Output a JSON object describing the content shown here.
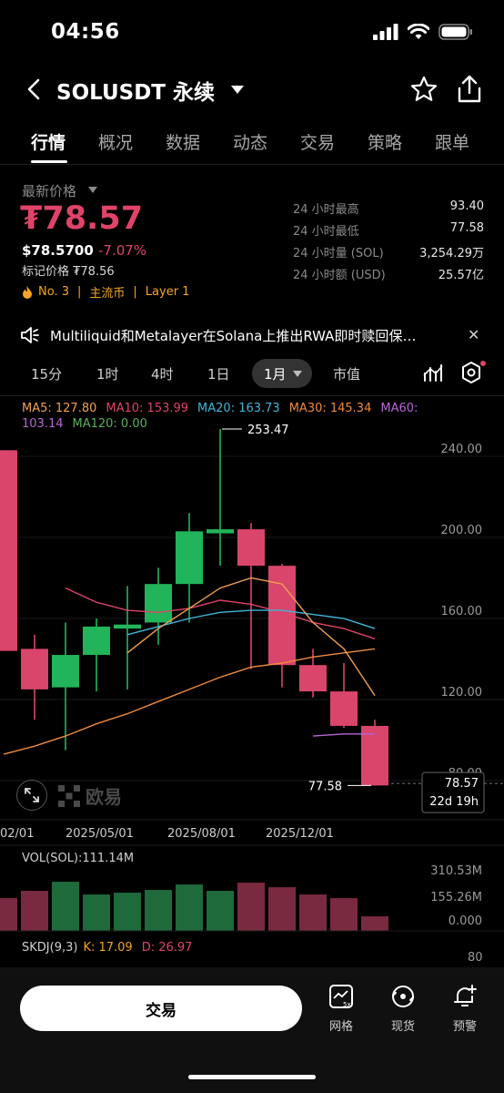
{
  "status": {
    "time": "04:56"
  },
  "header": {
    "pair": "SOLUSDT 永续"
  },
  "tabs": [
    "行情",
    "概况",
    "数据",
    "动态",
    "交易",
    "策略",
    "跟单"
  ],
  "price": {
    "label": "最新价格",
    "value": "₮78.57",
    "usd": "$78.5700",
    "change": "-7.07%",
    "mark": "标记价格 ₮78.56",
    "tags": [
      "No. 3",
      "主流币",
      "Layer 1"
    ]
  },
  "stats": [
    {
      "label": "24 小时最高",
      "value": "93.40"
    },
    {
      "label": "24 小时最低",
      "value": "77.58"
    },
    {
      "label": "24 小时量 (SOL)",
      "value": "3,254.29万"
    },
    {
      "label": "24 小时额 (USD)",
      "value": "25.57亿"
    }
  ],
  "news": {
    "text": "Multiliquid和Metalayer在Solana上推出RWA即时赎回保…"
  },
  "intervals": [
    "15分",
    "1时",
    "4时",
    "1日",
    "1月",
    "市值"
  ],
  "ma_legend": {
    "ma5": "MA5: 127.80",
    "ma10": "MA10: 153.99",
    "ma20": "MA20: 163.73",
    "ma30": "MA30: 145.34",
    "ma60": "MA60:",
    "ma60_value": "103.14",
    "ma120": "MA120: 0.00"
  },
  "colors": {
    "up": "#22b45a",
    "down": "#d9456b",
    "ma5": "#f0a050",
    "ma10": "#e0436a",
    "ma20": "#3fb6d8",
    "ma30": "#ef8a3c",
    "ma60": "#b866d6",
    "ma120": "#5ab05a"
  },
  "chart_data": {
    "type": "candlestick",
    "y_ticks": [
      "240.00",
      "200.00",
      "160.00",
      "120.00",
      "80.00"
    ],
    "x_ticks": [
      "02/01",
      "2025/05/01",
      "2025/08/01",
      "2025/12/01"
    ],
    "high_label": "253.47",
    "low_label": "77.58",
    "last_price": "78.57",
    "countdown": "22d 19h",
    "candles": [
      {
        "open": 243,
        "close": 144,
        "high": 243,
        "low": 144
      },
      {
        "open": 145,
        "close": 125,
        "high": 152,
        "low": 110
      },
      {
        "open": 126,
        "close": 142,
        "high": 158,
        "low": 95
      },
      {
        "open": 142,
        "close": 156,
        "high": 160,
        "low": 124
      },
      {
        "open": 155,
        "close": 157,
        "high": 176,
        "low": 125
      },
      {
        "open": 158,
        "close": 177,
        "high": 185,
        "low": 147
      },
      {
        "open": 177,
        "close": 203,
        "high": 212,
        "low": 158
      },
      {
        "open": 202,
        "close": 204,
        "high": 253.47,
        "low": 186
      },
      {
        "open": 204,
        "close": 186,
        "high": 207,
        "low": 135
      },
      {
        "open": 186,
        "close": 137,
        "high": 187,
        "low": 126
      },
      {
        "open": 137,
        "close": 124,
        "high": 145,
        "low": 121
      },
      {
        "open": 124,
        "close": 107,
        "high": 138,
        "low": 106
      },
      {
        "open": 107,
        "close": 77.58,
        "high": 110,
        "low": 77.58
      }
    ],
    "ma5": [
      null,
      null,
      null,
      null,
      143,
      155,
      165,
      175,
      180,
      177,
      158,
      145,
      122
    ],
    "ma10": [
      null,
      null,
      175,
      168,
      164,
      163,
      165,
      169,
      167,
      163,
      158,
      155,
      150
    ],
    "ma20": [
      null,
      null,
      null,
      null,
      152,
      156,
      160,
      163,
      164,
      164,
      162,
      160,
      155
    ],
    "ma30": [
      93,
      97,
      102,
      108,
      113,
      119,
      125,
      131,
      136,
      138,
      141,
      143,
      145
    ],
    "ma60": [
      null,
      null,
      null,
      null,
      null,
      null,
      null,
      null,
      null,
      null,
      102,
      103,
      103
    ],
    "volume_label": "VOL(SOL):111.14M",
    "volume_ticks": [
      "310.53M",
      "155.26M",
      "0.000"
    ],
    "volumes": [
      180,
      220,
      270,
      200,
      210,
      225,
      255,
      220,
      265,
      240,
      200,
      180,
      80
    ]
  },
  "skdj": {
    "label": "SKDJ(9,3)",
    "k": "K: 17.09",
    "d": "D: 26.97",
    "level": "80"
  },
  "watermark": "欧易",
  "bottom": {
    "trade": "交易",
    "grid": "网格",
    "spot": "现货",
    "alert": "预警"
  }
}
